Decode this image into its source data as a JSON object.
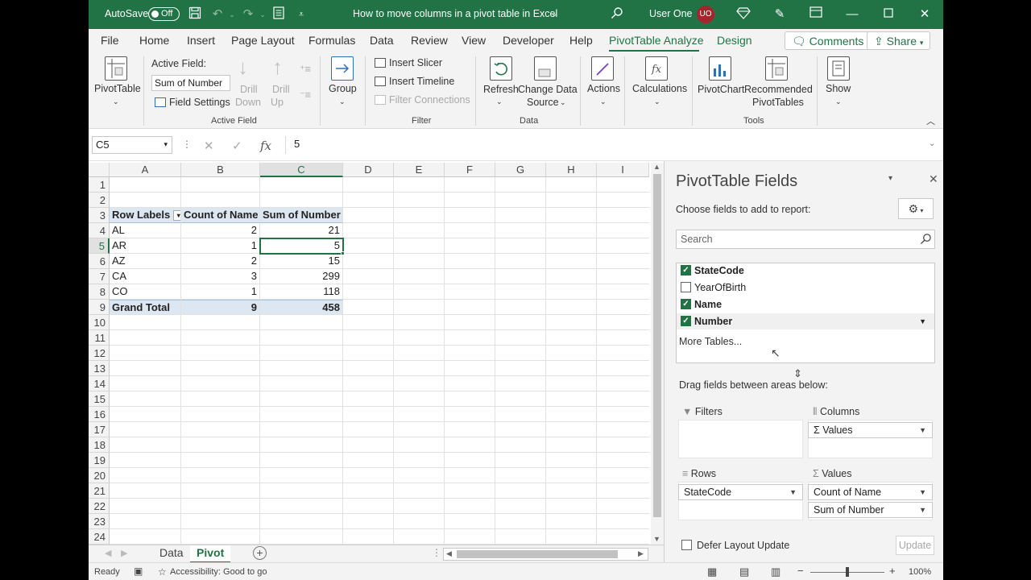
{
  "titlebar": {
    "autosave_label": "AutoSave",
    "autosave_state": "Off",
    "document_title": "How to move columns in a pivot table in Excel",
    "user_name": "User One",
    "user_initials": "UO"
  },
  "ribbon_tabs": [
    "File",
    "Home",
    "Insert",
    "Page Layout",
    "Formulas",
    "Data",
    "Review",
    "View",
    "Developer",
    "Help",
    "PivotTable Analyze",
    "Design"
  ],
  "active_tab": "PivotTable Analyze",
  "comments_label": "Comments",
  "share_label": "Share",
  "ribbon": {
    "pivottable_label": "PivotTable",
    "active_field_label": "Active Field:",
    "active_field_value": "Sum of Number",
    "field_settings_label": "Field Settings",
    "drill_down_1": "Drill",
    "drill_down_2": "Down",
    "drill_up_1": "Drill",
    "drill_up_2": "Up",
    "group_active_field": "Active Field",
    "group_label": "Group",
    "insert_slicer": "Insert Slicer",
    "insert_timeline": "Insert Timeline",
    "filter_connections": "Filter Connections",
    "group_filter": "Filter",
    "refresh_label": "Refresh",
    "change_data_1": "Change Data",
    "change_data_2": "Source",
    "group_data": "Data",
    "actions_label": "Actions",
    "calculations_label": "Calculations",
    "pivotchart_label": "PivotChart",
    "recommended_1": "Recommended",
    "recommended_2": "PivotTables",
    "group_tools": "Tools",
    "show_label": "Show"
  },
  "formula_bar": {
    "name_box": "C5",
    "formula": "5"
  },
  "grid": {
    "columns": [
      "A",
      "B",
      "C",
      "D",
      "E",
      "F",
      "G",
      "H",
      "I"
    ],
    "selected_column": "C",
    "rows": [
      "1",
      "2",
      "3",
      "4",
      "5",
      "6",
      "7",
      "8",
      "9",
      "10",
      "11",
      "12",
      "13",
      "14",
      "15",
      "16",
      "17",
      "18",
      "19",
      "20",
      "21",
      "22",
      "23",
      "24"
    ],
    "selected_row": "5",
    "pivot_headers": [
      "Row Labels",
      "Count of Name",
      "Sum of Number"
    ],
    "pivot_rows": [
      [
        "AL",
        "2",
        "21"
      ],
      [
        "AR",
        "1",
        "5"
      ],
      [
        "AZ",
        "2",
        "15"
      ],
      [
        "CA",
        "3",
        "299"
      ],
      [
        "CO",
        "1",
        "118"
      ]
    ],
    "grand_total": [
      "Grand Total",
      "9",
      "458"
    ]
  },
  "sheets": [
    "Data",
    "Pivot"
  ],
  "active_sheet": "Pivot",
  "statusbar": {
    "ready": "Ready",
    "accessibility": "Accessibility: Good to go",
    "zoom": "100%"
  },
  "pane": {
    "title": "PivotTable Fields",
    "choose_label": "Choose fields to add to report:",
    "search_placeholder": "Search",
    "fields": [
      {
        "name": "StateCode",
        "checked": true
      },
      {
        "name": "YearOfBirth",
        "checked": false
      },
      {
        "name": "Name",
        "checked": true
      },
      {
        "name": "Number",
        "checked": true
      }
    ],
    "more_tables": "More Tables...",
    "drag_label": "Drag fields between areas below:",
    "filters_label": "Filters",
    "columns_label": "Columns",
    "rows_label": "Rows",
    "values_label": "Values",
    "columns_item": "Values",
    "rows_item": "StateCode",
    "values_items": [
      "Count of Name",
      "Sum of Number"
    ],
    "defer_label": "Defer Layout Update",
    "update_label": "Update"
  },
  "colors": {
    "excel_green": "#217346",
    "pivot_header_fill": "#dde7f2"
  }
}
